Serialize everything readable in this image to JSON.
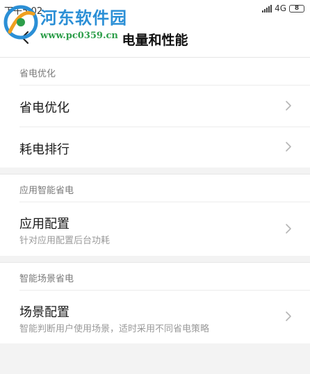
{
  "status_bar": {
    "time": "下午5:02",
    "network": "4G",
    "battery": "8"
  },
  "header": {
    "title": "电量和性能",
    "back_icon": "back-arrow-icon"
  },
  "watermark": {
    "name": "河东软件园",
    "url": "www.pc0359.cn"
  },
  "sections": [
    {
      "header": "省电优化",
      "items": [
        {
          "title": "省电优化",
          "subtitle": "",
          "icon": "chevron-right-icon"
        },
        {
          "title": "耗电排行",
          "subtitle": "",
          "icon": "chevron-right-icon"
        }
      ]
    },
    {
      "header": "应用智能省电",
      "items": [
        {
          "title": "应用配置",
          "subtitle": "针对应用配置后台功耗",
          "icon": "chevron-right-icon"
        }
      ]
    },
    {
      "header": "智能场景省电",
      "items": [
        {
          "title": "场景配置",
          "subtitle": "智能判断用户使用场景，适时采用不同省电策略",
          "icon": "chevron-right-icon"
        }
      ]
    }
  ],
  "colors": {
    "background": "#f3f3f3",
    "card": "#ffffff",
    "watermark_blue": "#2b8fd6",
    "watermark_green": "#2d9e4a"
  }
}
